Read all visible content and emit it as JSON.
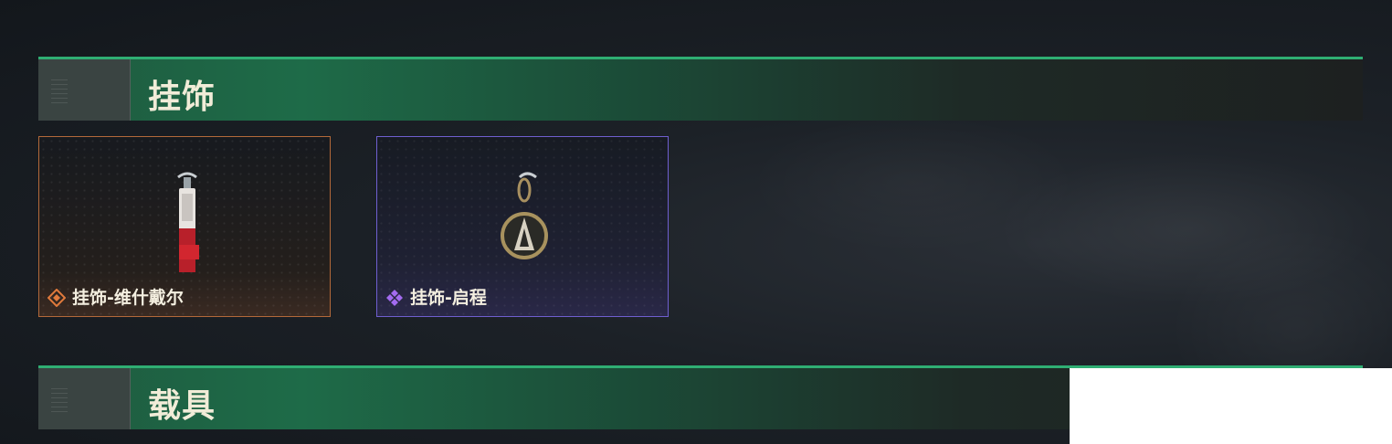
{
  "sections": [
    {
      "title": "挂饰"
    },
    {
      "title": "载具"
    }
  ],
  "items": [
    {
      "name": "挂饰-维什戴尔",
      "rarity_color": "#e07a3c",
      "icon": "orange-rarity-diamond-icon"
    },
    {
      "name": "挂饰-启程",
      "rarity_color": "#a36bf0",
      "icon": "purple-rarity-diamond-icon"
    }
  ],
  "colors": {
    "header_accent": "#2fae73",
    "orange_border": "#b3693a",
    "purple_border": "#6f5fd0"
  }
}
